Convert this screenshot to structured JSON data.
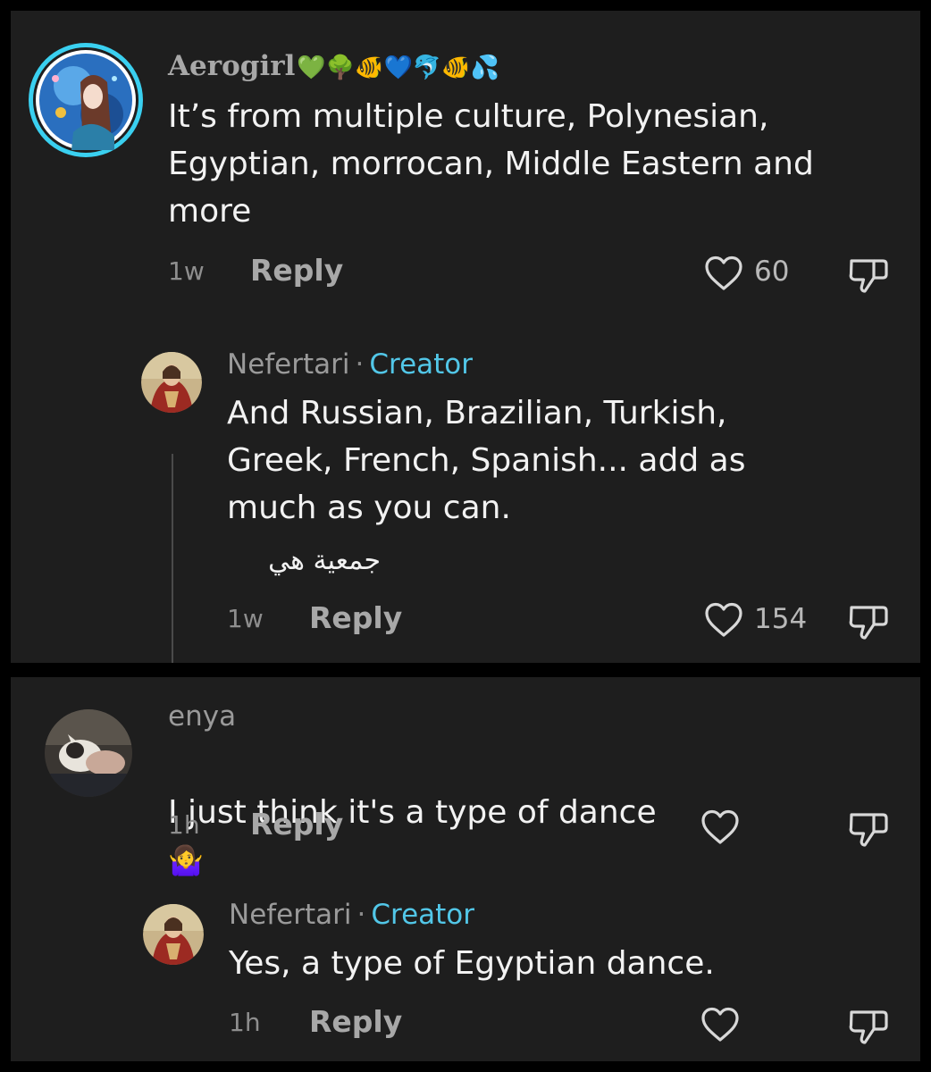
{
  "colors": {
    "background": "#1e1e1e",
    "creator_badge": "#52c7e8",
    "body_text": "#f2f2f2",
    "secondary_text": "#9a9a9a"
  },
  "comments": [
    {
      "username": "Aerogirl",
      "username_emojis": "💚🌳🐠💙🐬🐠💦",
      "text": "It’s from multiple culture, Polynesian,\nEgyptian, morrocan, Middle Eastern and\nmore",
      "time": "1w",
      "reply_label": "Reply",
      "likes": "60",
      "replies": [
        {
          "username": "Nefertari",
          "separator": "·",
          "badge": "Creator",
          "text": "And Russian, Brazilian, Turkish,\nGreek, French, Spanish... add as\nmuch as you can.",
          "extra_text": "جمعية هي",
          "time": "1w",
          "reply_label": "Reply",
          "likes": "154"
        }
      ]
    },
    {
      "username": "enya",
      "text": "I just think it's a type of dance",
      "emoji": "🤷‍♀️",
      "time": "1h",
      "reply_label": "Reply",
      "likes": "",
      "replies": [
        {
          "username": "Nefertari",
          "separator": "·",
          "badge": "Creator",
          "text": "Yes, a type of Egyptian dance.",
          "time": "1h",
          "reply_label": "Reply",
          "likes": ""
        }
      ]
    }
  ]
}
